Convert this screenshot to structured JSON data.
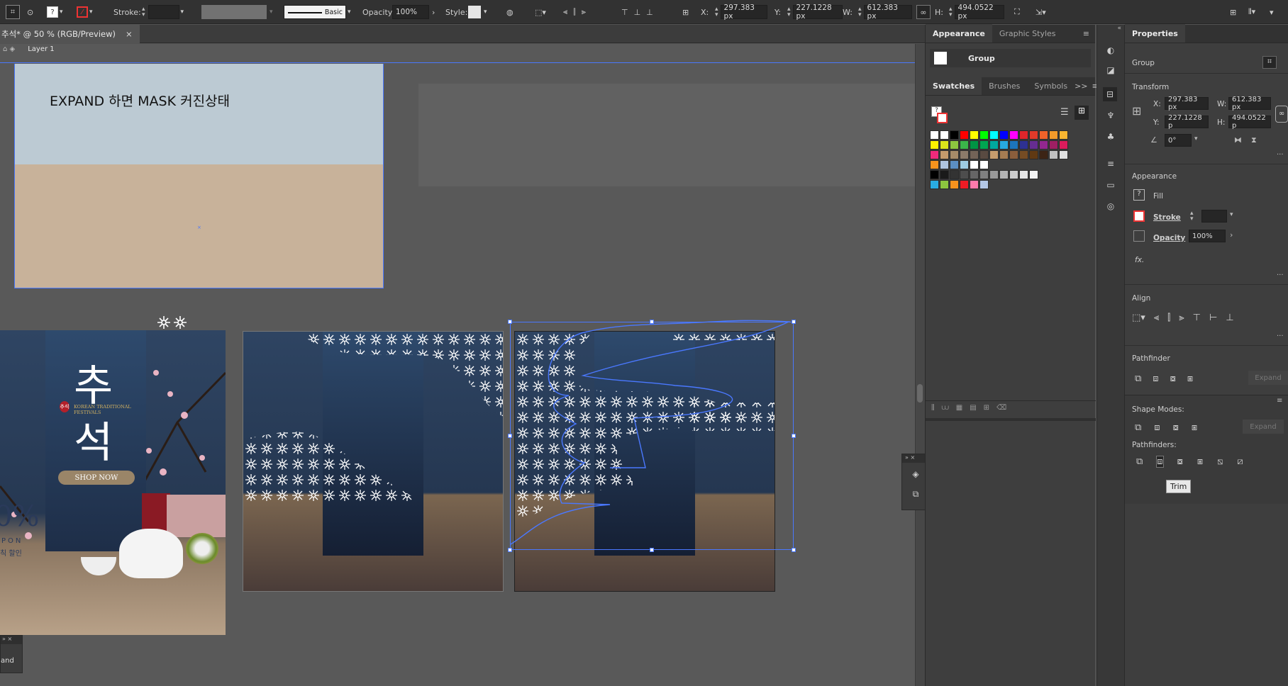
{
  "toolbar": {
    "stroke_label": "Stroke:",
    "stroke_value": "",
    "brush_label": "Basic",
    "opacity_label": "Opacity:",
    "opacity_value": "100%",
    "style_label": "Style:",
    "x_label": "X:",
    "x_value": "297.383 px",
    "y_label": "Y:",
    "y_value": "227.1228 px",
    "w_label": "W:",
    "w_value": "612.383 px",
    "h_label": "H:",
    "h_value": "494.0522 px"
  },
  "document": {
    "tab_title": "추석* @ 50 % (RGB/Preview)",
    "close": "×",
    "layer_name": "Layer 1"
  },
  "artboard": {
    "caption": "EXPAND 하면 MASK 커진상태",
    "poster_big_title_1": "추",
    "poster_big_title_2": "석",
    "poster_sub": "KOREAN TRADITIONAL FESTIVALS",
    "poster_stamp": "추석",
    "poster_button": "SHOP NOW",
    "poster_percent": "0%",
    "poster_on": "PON",
    "poster_sale": "칙 할인"
  },
  "panel_appearance": {
    "tabs": [
      "Appearance",
      "Graphic Styles"
    ],
    "active_tab": "Appearance",
    "object": "Group"
  },
  "panel_swatches": {
    "tabs": [
      "Swatches",
      "Brushes",
      "Symbols"
    ],
    "active_tab": "Swatches",
    "expand": ">>",
    "menu": "≡"
  },
  "swatch_colors": {
    "row1": [
      "#ffffff",
      "#ffffff",
      "#000000",
      "#ff0000",
      "#ffff00",
      "#00ff00",
      "#00ffff",
      "#0000ff",
      "#ff00ff",
      "#e0262b",
      "#e03a2a",
      "#f0622a",
      "#f39a2a",
      "#f7b531"
    ],
    "row2": [
      "#fff200",
      "#dce51b",
      "#8dc63f",
      "#3bb54a",
      "#009444",
      "#00a651",
      "#00a99d",
      "#27aae1",
      "#1c75bc",
      "#2e3192",
      "#662d91",
      "#92278f",
      "#9e1f63",
      "#da1c5c"
    ],
    "row3": [
      "#ee2a7b",
      "#c49a6c",
      "#a68b68",
      "#8c7b6a",
      "#736357",
      "#594a41",
      "#c69c6d",
      "#a67c52",
      "#8b5e3c",
      "#754c24",
      "#603913",
      "#3c2415",
      "#c0c0c0",
      "#e0e0e0"
    ],
    "row4": [
      "#f7941d",
      "#b0c4de",
      "#5c8ec2",
      "#9ecbe1",
      "#ffffff",
      "#ffffff"
    ],
    "row5": [
      "#000000",
      "#1a1a1a",
      "#333333",
      "#4d4d4d",
      "#666666",
      "#808080",
      "#999999",
      "#b3b3b3",
      "#cccccc",
      "#e6e6e6",
      "#f2f2f2"
    ],
    "row6": [
      "#29abe2",
      "#8cc63f",
      "#f7931e",
      "#ed1c24",
      "#ff7bac",
      "#b3c7e6"
    ]
  },
  "panel_properties": {
    "title": "Properties",
    "object": "Group",
    "transform_label": "Transform",
    "x_label": "X:",
    "x_value": "297.383 px",
    "y_label": "Y:",
    "y_value": "227.1228 p",
    "w_label": "W:",
    "w_value": "612.383 px",
    "h_label": "H:",
    "h_value": "494.0522 p",
    "angle_value": "0°",
    "appearance_label": "Appearance",
    "fill_label": "Fill",
    "stroke_label": "Stroke",
    "opacity_label": "Opacity",
    "opacity_value": "100%",
    "fx_label": "fx.",
    "align_label": "Align",
    "pathfinder_label": "Pathfinder",
    "expand_label": "Expand",
    "shape_modes_label": "Shape Modes:",
    "pathfinders_label": "Pathfinders:",
    "expand2_label": "Expand",
    "tooltip": "Trim"
  },
  "mini_panel": {
    "label": "and"
  }
}
